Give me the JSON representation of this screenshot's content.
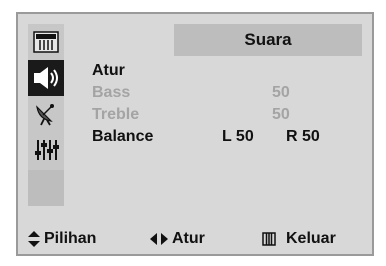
{
  "header": {
    "title": "Suara"
  },
  "menu": {
    "title": "Atur",
    "items": [
      {
        "label": "Bass",
        "value": "50",
        "enabled": false
      },
      {
        "label": "Treble",
        "value": "50",
        "enabled": false
      },
      {
        "label": "Balance",
        "left": "L 50",
        "right": "R 50",
        "enabled": true
      }
    ]
  },
  "sidebar": {
    "icons": [
      "picture-icon",
      "speaker-icon",
      "satellite-dish-icon",
      "equalizer-icon"
    ]
  },
  "footer": {
    "move_label": "Pilihan",
    "adjust_label": "Atur",
    "exit_label": "Keluar"
  },
  "colors": {
    "background": "#d8d8d8",
    "active_icon_bg": "#1a1a1a",
    "dim_text": "#a4a4a4"
  }
}
